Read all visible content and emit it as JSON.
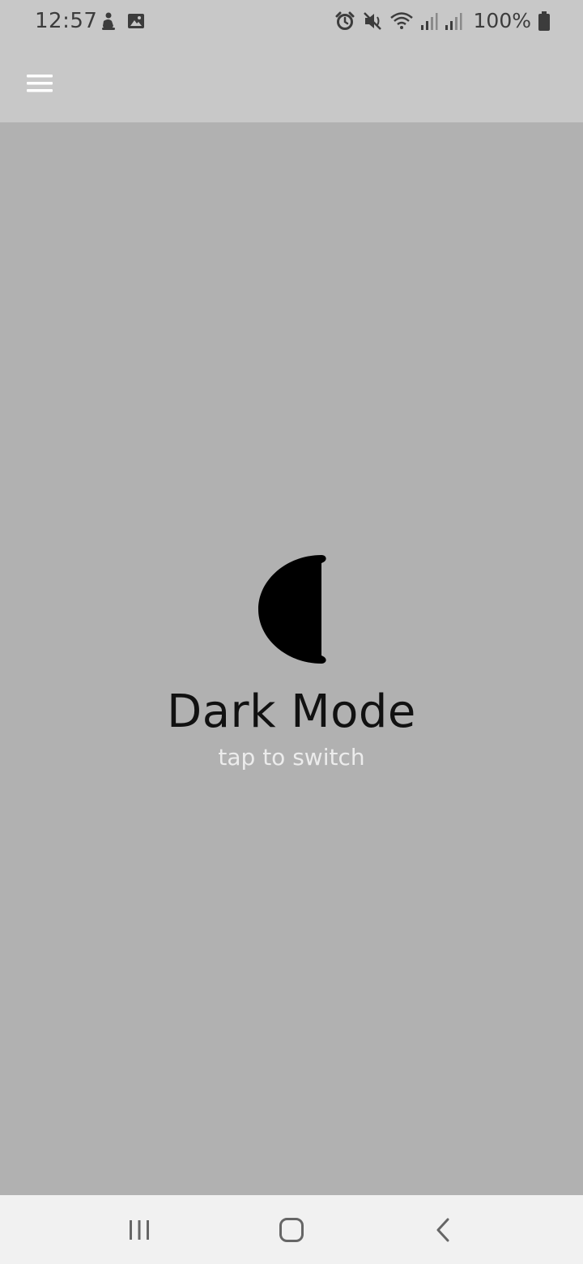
{
  "status_bar": {
    "time": "12:57",
    "battery_percent": "100%",
    "left_icons": [
      "gesture-person-icon",
      "image-icon"
    ],
    "right_icons": [
      "alarm-icon",
      "mute-icon",
      "wifi-icon",
      "signal-icon",
      "signal-icon",
      "battery-icon"
    ]
  },
  "app_bar": {
    "menu_icon": "hamburger-menu-icon"
  },
  "main": {
    "icon": "moon-icon",
    "title": "Dark Mode",
    "hint": "tap to switch"
  },
  "nav_bar": {
    "buttons": [
      "recent-apps",
      "home",
      "back"
    ]
  },
  "colors": {
    "background": "#b1b1b1",
    "app_bar": "#c8c8c8",
    "nav_bar": "#f1f1f1",
    "title": "#111111",
    "hint": "#ececec"
  }
}
